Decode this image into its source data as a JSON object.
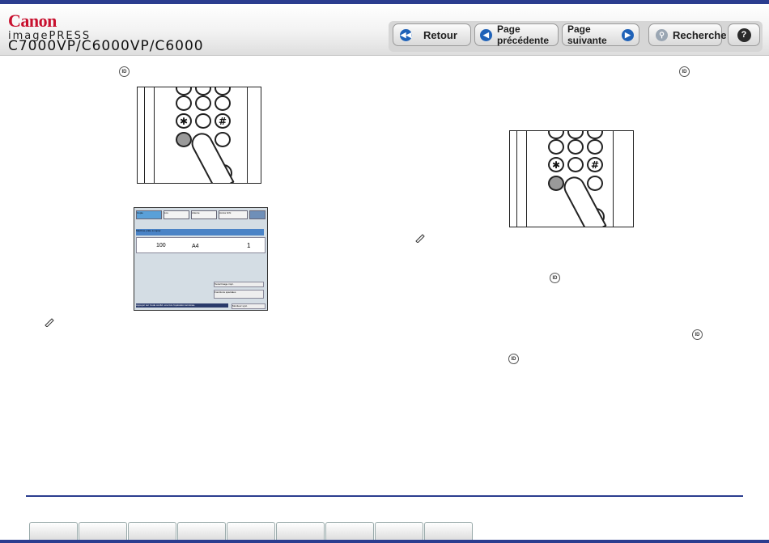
{
  "header": {
    "brand": "Canon",
    "product_line": "imagePRESS",
    "model": "C7000VP/C6000VP/C6000"
  },
  "nav": {
    "back_label": "Retour",
    "prev_label": "Page précédente",
    "next_label": "Page suivante",
    "search_label": "Recherche",
    "help_icon": "?"
  },
  "id_key_glyph": "ID",
  "keypad_keys": [
    "✱",
    "#"
  ],
  "panel": {
    "tabs": [
      "Copie",
      "Lire",
      "Attente",
      "Accès fichi"
    ],
    "status": "Machine prête à copier.",
    "ratio": "100",
    "paper": "A4",
    "count": "1",
    "mode": "Texte/Image impr.",
    "special": "Fonctions spéciales",
    "message": "Appuyer sur Code confid. une fois l'opération terminée.",
    "monitor": "Moniteur syst."
  },
  "footer_tabs": [
    {
      "label": ""
    },
    {
      "label": ""
    },
    {
      "label": ""
    },
    {
      "label": ""
    },
    {
      "label": ""
    },
    {
      "label": ""
    },
    {
      "label": ""
    },
    {
      "label": ""
    },
    {
      "label": ""
    }
  ],
  "colors": {
    "accent": "#2b3d8f",
    "brand": "#c8102e",
    "nav_icon": "#1f62b8"
  }
}
